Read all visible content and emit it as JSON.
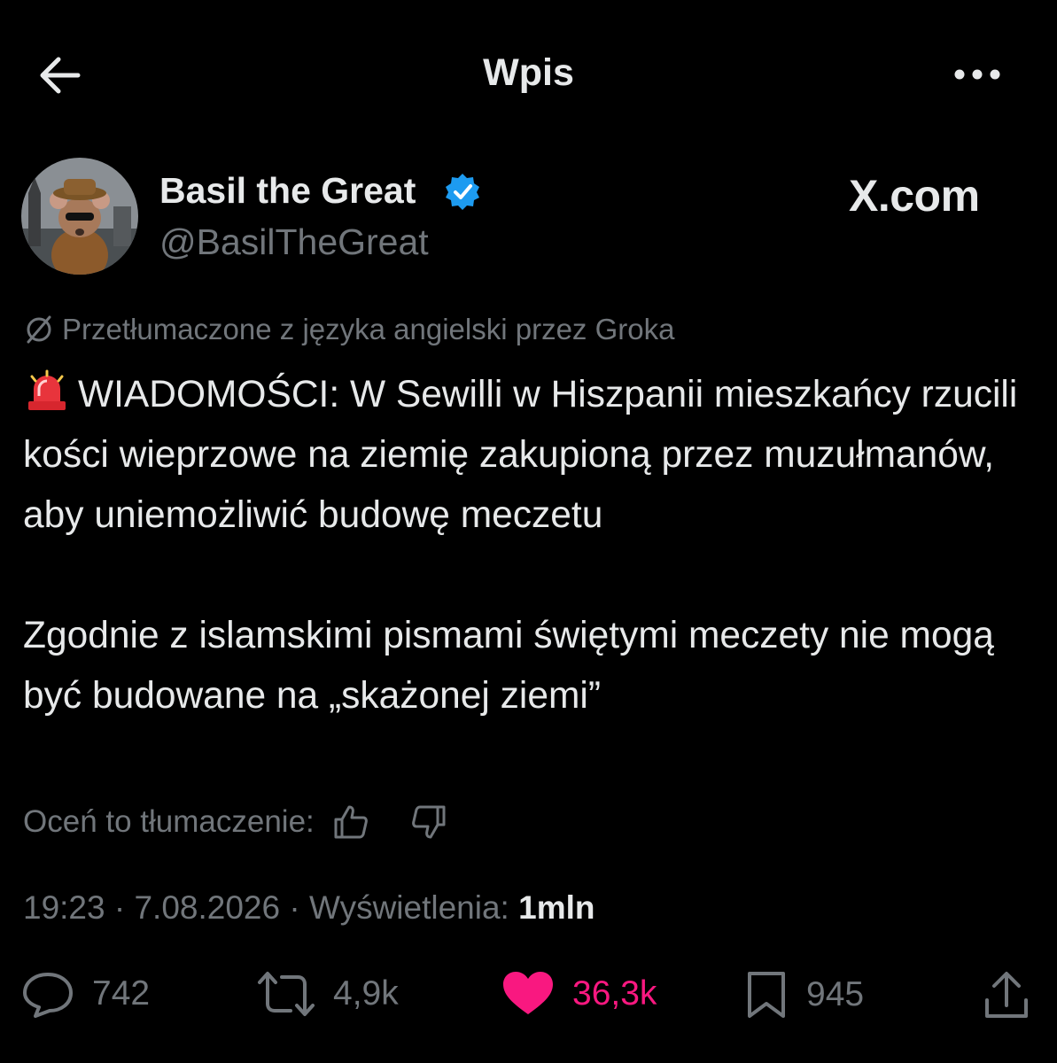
{
  "header": {
    "title": "Wpis"
  },
  "author": {
    "display_name": "Basil the Great",
    "handle": "@BasilTheGreat",
    "verified": true
  },
  "brand": {
    "watermark": "X.com"
  },
  "translation": {
    "notice": "Przetłumaczone z języka angielski przez Groka",
    "rate_label": "Oceń to tłumaczenie:"
  },
  "post": {
    "paragraphs": [
      "WIADOMOŚCI: W Sewilli w Hiszpanii mieszkańcy rzucili kości wieprzowe na ziemię zakupioną przez muzułmanów, aby uniemożliwić budowę meczetu",
      "Zgodnie z islamskimi pismami świętymi meczety nie mogą być budowane na „skażonej ziemi”"
    ]
  },
  "meta": {
    "time": "19:23",
    "date": "7.08.2026",
    "views_label": "Wyświetlenia:",
    "views_value": "1mln",
    "separator": " · "
  },
  "actions": {
    "replies": "742",
    "reposts": "4,9k",
    "likes": "36,3k",
    "bookmarks": "945"
  },
  "colors": {
    "background": "#000000",
    "text": "#e7e9ea",
    "muted": "#71767b",
    "like": "#f91880",
    "verified": "#1d9bf0"
  },
  "icons": [
    "back-arrow-icon",
    "more-dots-icon",
    "verified-badge-icon",
    "grok-translate-icon",
    "siren-emoji-icon",
    "thumbs-up-icon",
    "thumbs-down-icon",
    "reply-icon",
    "repost-icon",
    "heart-icon",
    "bookmark-icon",
    "share-icon"
  ]
}
